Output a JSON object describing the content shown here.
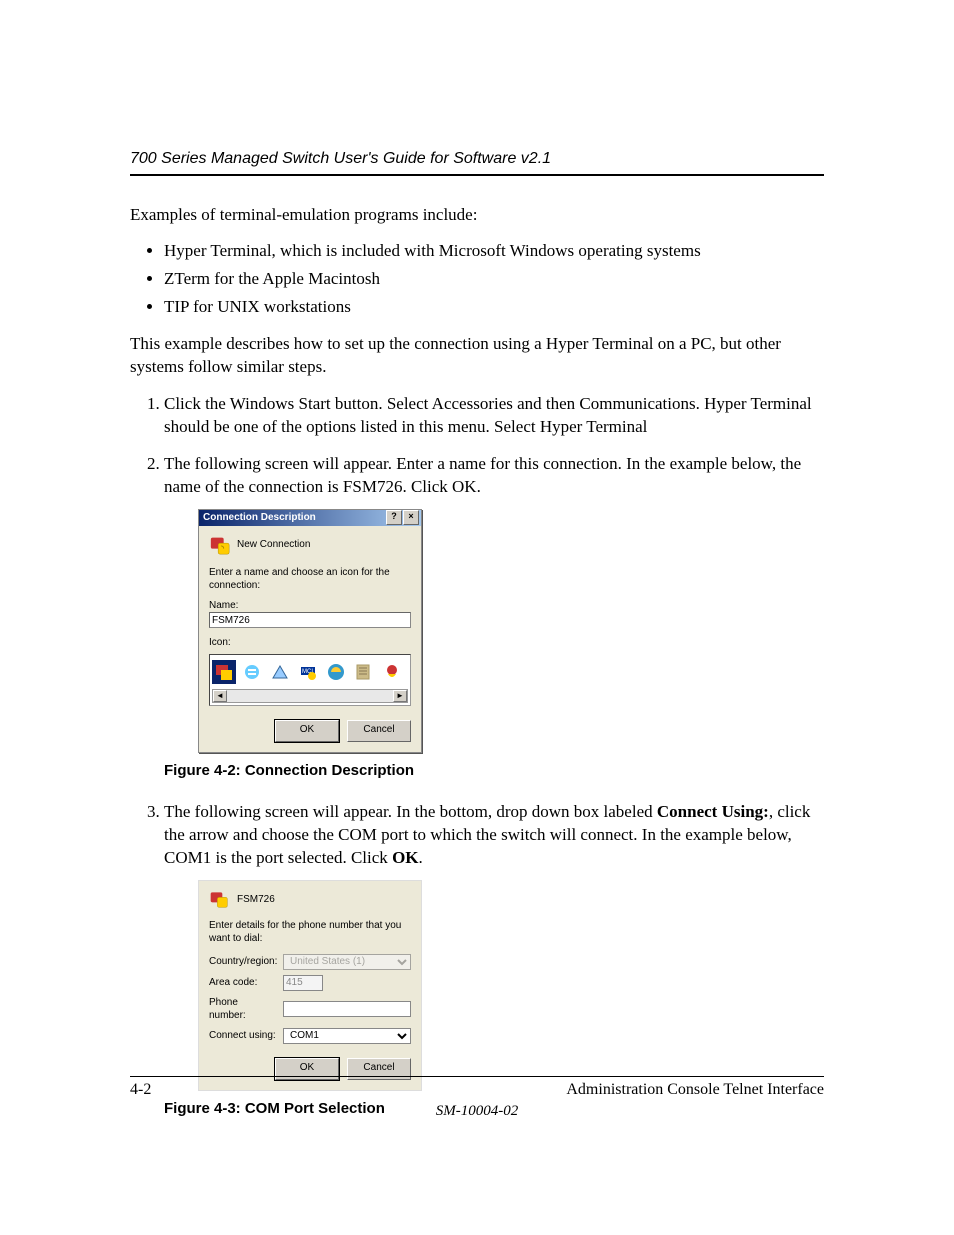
{
  "header": {
    "title": "700 Series Managed Switch User's Guide for Software v2.1"
  },
  "intro": "Examples of terminal-emulation programs include:",
  "bullets": [
    "Hyper Terminal, which is included with Microsoft Windows operating systems",
    "ZTerm for the Apple Macintosh",
    "TIP for UNIX workstations"
  ],
  "para2": "This example describes how to set up the connection using a Hyper Terminal on a PC, but other systems follow similar steps.",
  "steps": {
    "s1": "Click the Windows Start button. Select Accessories and then Communications.  Hyper Terminal should be one of the options listed in this menu. Select Hyper Terminal",
    "s2": "The following screen will appear. Enter a name for this connection. In the example below, the name of the connection is FSM726. Click OK.",
    "s3_a": "The following screen will appear. In the bottom, drop down box labeled ",
    "s3_b": "Connect Using:",
    "s3_c": ", click the arrow and choose the COM port to which the switch will connect. In the example below, COM1 is the port selected. Click ",
    "s3_d": "OK",
    "s3_e": "."
  },
  "dlg1": {
    "title": "Connection Description",
    "help_btn": "?",
    "close_btn": "×",
    "new_conn": "New Connection",
    "prompt": "Enter a name and choose an icon for the connection:",
    "name_label": "Name:",
    "name_value": "FSM726",
    "icon_label": "Icon:",
    "mci_badge": "MCI",
    "scroll_left": "◄",
    "scroll_right": "►",
    "ok": "OK",
    "cancel": "Cancel"
  },
  "fig1": "Figure 4-2:  Connection Description",
  "dlg2": {
    "title": "FSM726",
    "prompt": "Enter details for the phone number that you want to dial:",
    "country_label": "Country/region:",
    "country_value": "United States (1)",
    "area_label": "Area code:",
    "area_value": "415",
    "phone_label": "Phone number:",
    "phone_value": "",
    "connect_label": "Connect using:",
    "connect_value": "COM1",
    "ok": "OK",
    "cancel": "Cancel"
  },
  "fig2": "Figure 4-3:  COM Port Selection",
  "footer": {
    "page": "4-2",
    "section": "Administration Console Telnet Interface",
    "docnum": "SM-10004-02"
  }
}
